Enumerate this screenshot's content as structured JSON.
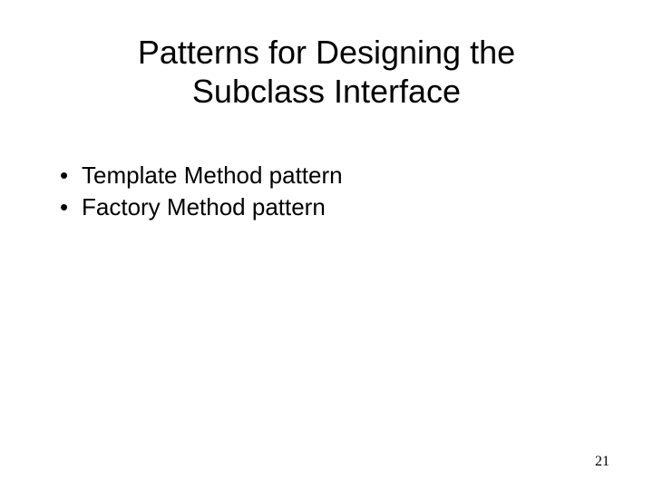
{
  "slide": {
    "title": "Patterns for Designing the Subclass Interface",
    "bullets": [
      "Template Method pattern",
      "Factory Method pattern"
    ],
    "page_number": "21"
  }
}
